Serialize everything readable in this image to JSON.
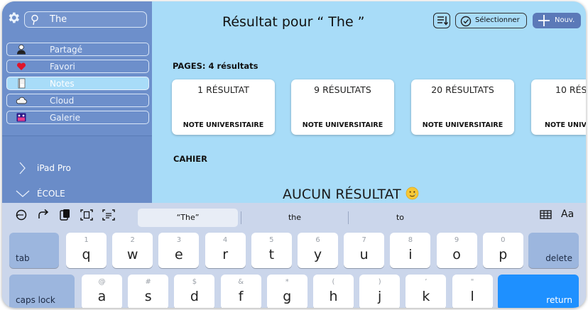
{
  "search": {
    "query": "The"
  },
  "sidebar": {
    "items": [
      {
        "label": "Partagé",
        "icon": "person-icon"
      },
      {
        "label": "Favori",
        "icon": "heart-icon"
      },
      {
        "label": "Notes",
        "icon": "notebook-icon",
        "active": true
      },
      {
        "label": "Cloud",
        "icon": "cloud-icon"
      },
      {
        "label": "Galerie",
        "icon": "gallery-icon"
      }
    ],
    "folders": [
      {
        "label": "iPad Pro",
        "icon": "chevron-right-icon"
      },
      {
        "label": "ÉCOLE",
        "icon": "chevron-down-icon"
      }
    ]
  },
  "header": {
    "title": "Résultat pour “ The ”",
    "select_label": "Sélectionner",
    "new_label": "Nouv."
  },
  "pages": {
    "heading": "PAGES: 4 résultats",
    "cards": [
      {
        "count": "1 RÉSULTAT",
        "kind": "NOTE UNIVERSITAIRE"
      },
      {
        "count": "9 RÉSULTATS",
        "kind": "NOTE UNIVERSITAIRE"
      },
      {
        "count": "20 RÉSULTATS",
        "kind": "NOTE UNIVERSITAIRE"
      },
      {
        "count": "10 RÉS",
        "kind": "NOTE UNIV"
      }
    ]
  },
  "cahier": {
    "heading": "CAHIER",
    "empty_text": "AUCUN RÉSULTAT"
  },
  "keyboard": {
    "suggestions": [
      "“The”",
      "the",
      "to"
    ],
    "right_tool_label": "Aa",
    "row1": [
      {
        "sec": "1",
        "pri": "q"
      },
      {
        "sec": "2",
        "pri": "w"
      },
      {
        "sec": "3",
        "pri": "e"
      },
      {
        "sec": "4",
        "pri": "r"
      },
      {
        "sec": "5",
        "pri": "t"
      },
      {
        "sec": "6",
        "pri": "y"
      },
      {
        "sec": "7",
        "pri": "u"
      },
      {
        "sec": "8",
        "pri": "i"
      },
      {
        "sec": "9",
        "pri": "o"
      },
      {
        "sec": "0",
        "pri": "p"
      }
    ],
    "row2": [
      {
        "sec": "@",
        "pri": "a"
      },
      {
        "sec": "#",
        "pri": "s"
      },
      {
        "sec": "$",
        "pri": "d"
      },
      {
        "sec": "&",
        "pri": "f"
      },
      {
        "sec": "*",
        "pri": "g"
      },
      {
        "sec": "(",
        "pri": "h"
      },
      {
        "sec": ")",
        "pri": "j"
      },
      {
        "sec": "’",
        "pri": "k"
      },
      {
        "sec": "\"",
        "pri": "l"
      }
    ],
    "tab_label": "tab",
    "delete_label": "delete",
    "caps_label": "caps lock",
    "return_label": "return"
  },
  "colors": {
    "content_bg": "#a8dcf8",
    "sidebar_bg": "#6a8cc8",
    "accent": "#5b79b8",
    "return_key": "#1e90ff"
  }
}
